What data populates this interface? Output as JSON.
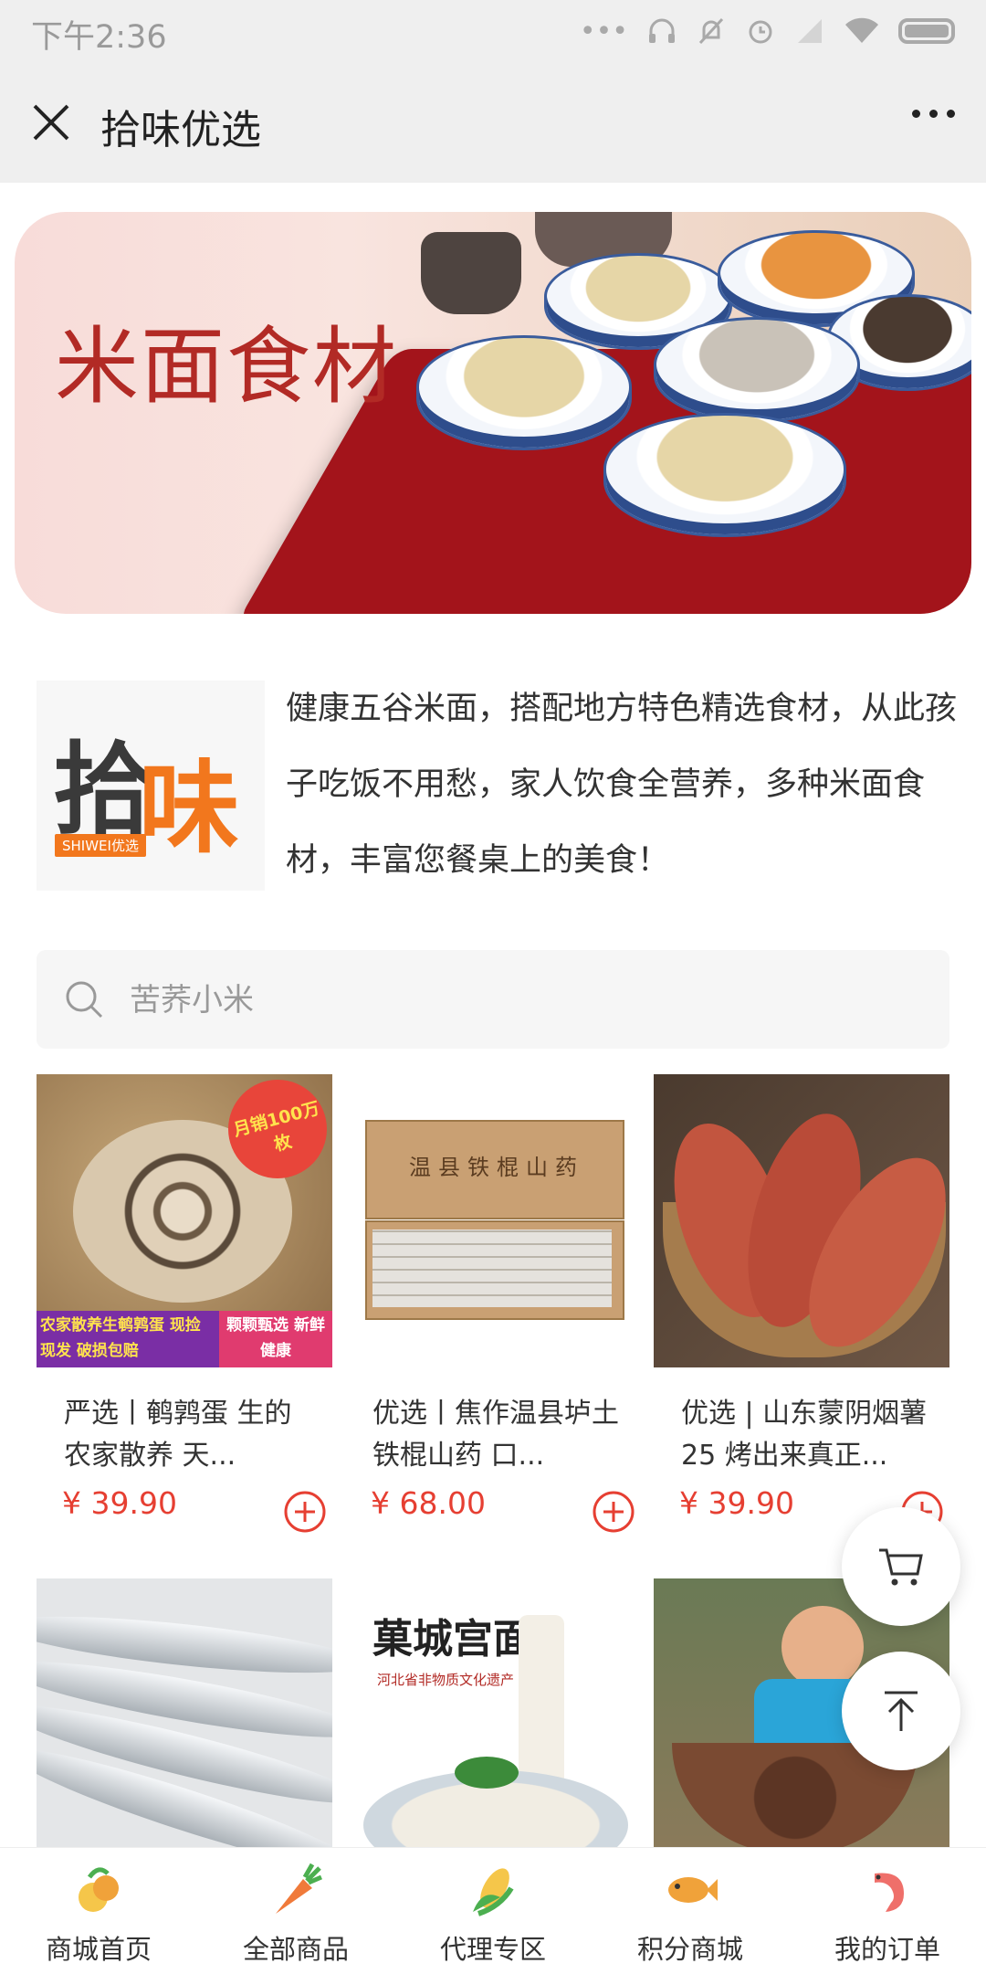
{
  "status": {
    "time": "下午2:36"
  },
  "header": {
    "title": "拾味优选"
  },
  "banner": {
    "title": "米面食材"
  },
  "intro": {
    "logo_text": "拾味",
    "logo_tag": "SHIWEI优选",
    "description": "健康五谷米面，搭配地方特色精选食材，从此孩子吃饭不用愁，家人饮食全营养，多种米面食材，丰富您餐桌上的美食！"
  },
  "search": {
    "placeholder": "苦荞小米"
  },
  "products": [
    {
      "name": "严选丨鹌鹑蛋 生的 农家散养 天...",
      "price": "¥ 39.90",
      "badge": "月销100万枚",
      "banner_left": "农家散养生鹌鹑蛋 现捡现发 破损包赔",
      "banner_right": "颗颗甄选 新鲜健康"
    },
    {
      "name": "优选丨焦作温县垆土 铁棍山药 口...",
      "price": "¥ 68.00",
      "box_text": "温县铁棍山药"
    },
    {
      "name": "优选 | 山东蒙阴烟薯25 烤出来真正...",
      "price": "¥ 39.90"
    },
    {
      "name": "",
      "price": ""
    },
    {
      "name": "",
      "price": "",
      "brand_text": "菓城宫面",
      "sub_text": "河北省非物质文化遗产"
    },
    {
      "name": "",
      "price": ""
    }
  ],
  "tabs": [
    {
      "label": "商城首页",
      "icon": "home-fruit-icon"
    },
    {
      "label": "全部商品",
      "icon": "carrot-icon"
    },
    {
      "label": "代理专区",
      "icon": "corn-icon"
    },
    {
      "label": "积分商城",
      "icon": "fish-icon"
    },
    {
      "label": "我的订单",
      "icon": "shrimp-icon"
    }
  ],
  "colors": {
    "price": "#e63f32",
    "brand_orange": "#f2771d",
    "banner_red": "#b22a25"
  }
}
